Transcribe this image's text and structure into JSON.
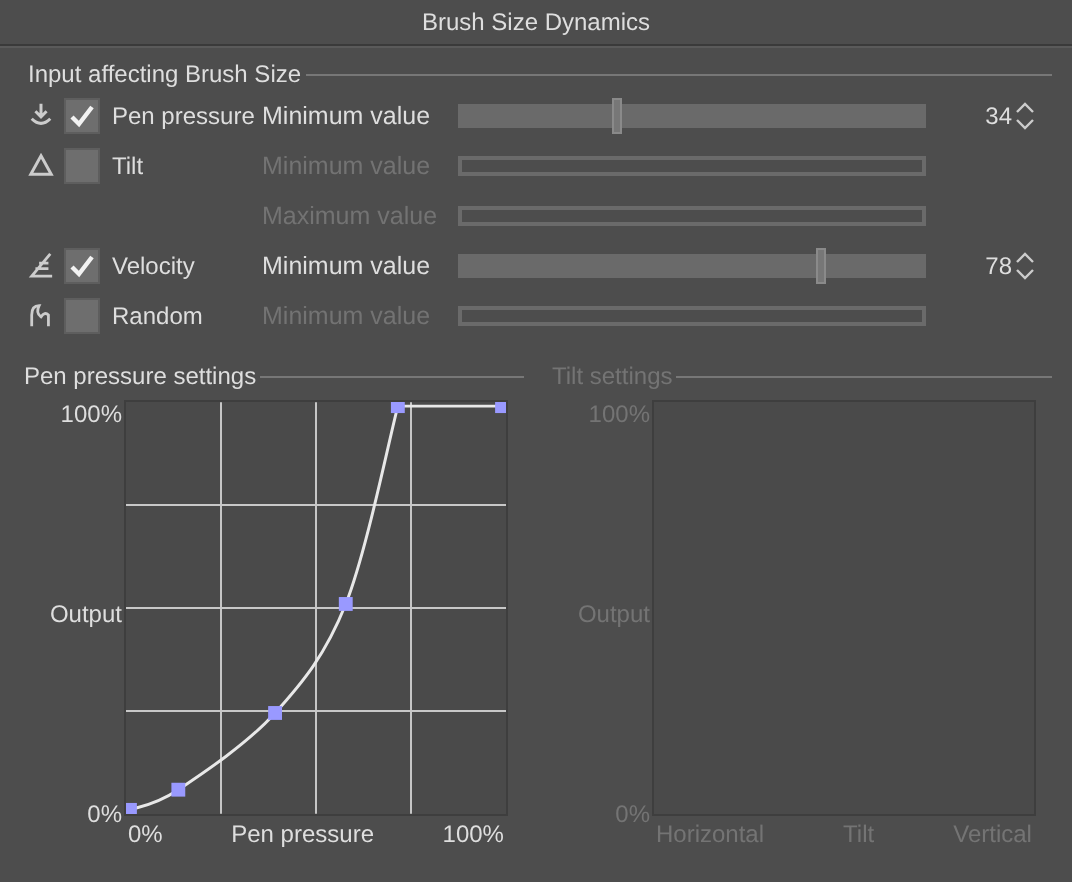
{
  "window": {
    "title": "Brush Size Dynamics"
  },
  "inputs_group": {
    "title": "Input affecting Brush Size",
    "inputs": [
      {
        "label": "Pen pressure",
        "checked": true,
        "settings": [
          {
            "label": "Minimum value",
            "disabled": false,
            "level": 0.34,
            "reading": "34"
          }
        ]
      },
      {
        "label": "Tilt",
        "checked": false,
        "settings": [
          {
            "label": "Minimum value",
            "disabled": true
          },
          {
            "label": "Maximum value",
            "disabled": true
          }
        ]
      },
      {
        "label": "Velocity",
        "checked": true,
        "settings": [
          {
            "label": "Minimum value",
            "disabled": false,
            "level": 0.78,
            "reading": "78"
          }
        ]
      },
      {
        "label": "Random",
        "checked": false,
        "settings": [
          {
            "label": "Minimum value",
            "disabled": true
          }
        ]
      }
    ]
  },
  "pen_pressure_settings": {
    "title": "Pen pressure settings",
    "disabled": false,
    "y_labels": [
      "100%",
      "Output",
      "0%"
    ],
    "x_labels": [
      "0%",
      "Pen pressure",
      "100%"
    ]
  },
  "tilt_settings": {
    "title": "Tilt settings",
    "disabled": true,
    "y_labels": [
      "100%",
      "Output",
      "0%"
    ],
    "x_labels": [
      "Horizontal",
      "Tilt",
      "Vertical"
    ]
  }
}
